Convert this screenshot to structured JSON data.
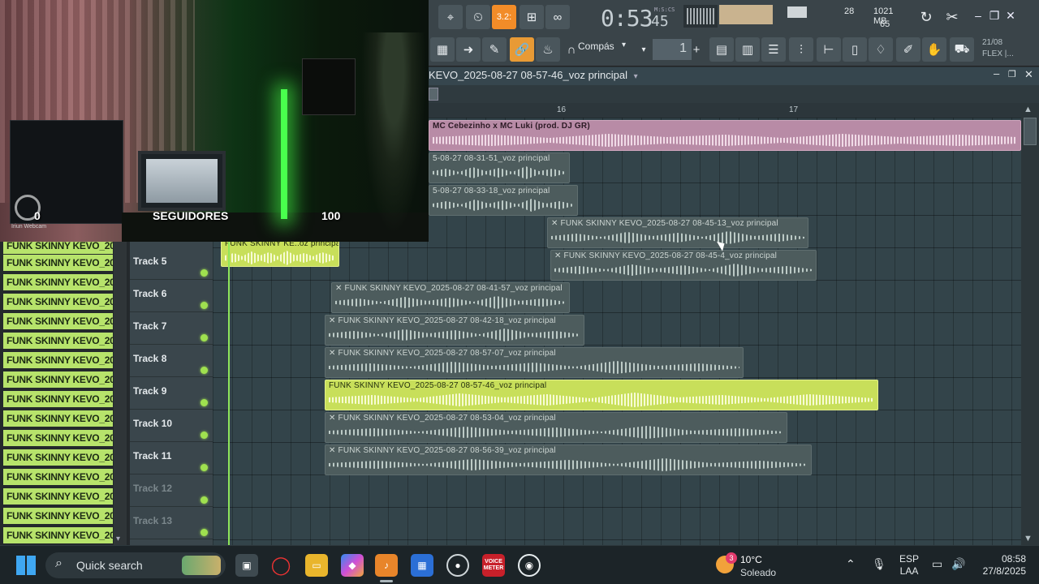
{
  "webcam": {
    "stat_left": "0",
    "stat_center": "SEGUIDORES",
    "stat_right": "100",
    "cam_label": "Iriun Webcam"
  },
  "toolbar": {
    "time": "0:53",
    "time_frac": "45",
    "time_unit": "M:S:CS",
    "tempo_display": "3.2:",
    "cpu_value": "28",
    "ram_value": "1021 MB",
    "poly_value": "65",
    "snap_label": "Compás",
    "pattern_number": "1",
    "pattern_plus": "+",
    "date_line1": "21/08",
    "date_line2": "FLEX |...",
    "date_sup": "2",
    "minimize": "–",
    "restore": "❐",
    "close": "✕"
  },
  "playlist": {
    "title": "KEVO_2025-08-27 08-57-46_voz principal",
    "ruler": [
      "16",
      "17"
    ],
    "minimize": "–",
    "restore": "❐",
    "close": "✕"
  },
  "browser": {
    "items": [
      "FUNK SKINNY KEVO_2025...",
      "FUNK SKINNY KEVO_2025...",
      "FUNK SKINNY KEVO_2025...",
      "FUNK SKINNY KEVO_2025...",
      "FUNK SKINNY KEVO_2025...",
      "FUNK SKINNY KEVO_2025...",
      "FUNK SKINNY KEVO_2025...",
      "FUNK SKINNY KEVO_2025...",
      "FUNK SKINNY KEVO_2025...",
      "FUNK SKINNY KEVO_2025...",
      "FUNK SKINNY KEVO_2025...",
      "FUNK SKINNY KEVO_2025...",
      "FUNK SKINNY KEVO_2025...",
      "FUNK SKINNY KEVO_2025...",
      "FUNK SKINNY KEVO_2025...",
      "FUNK SKINNY KEVO_2025..."
    ]
  },
  "tracks": [
    {
      "name": "Track 5"
    },
    {
      "name": "Track 6"
    },
    {
      "name": "Track 7"
    },
    {
      "name": "Track 8"
    },
    {
      "name": "Track 9"
    },
    {
      "name": "Track 10"
    },
    {
      "name": "Track 11"
    },
    {
      "name": "Track 12"
    },
    {
      "name": "Track 13"
    }
  ],
  "clips": {
    "c1": "MC Cebezinho x MC Luki (prod. DJ GR)",
    "c2": "5-08-27 08-31-51_voz principal",
    "c3": "5-08-27 08-33-18_voz principal",
    "c4": "✕ FUNK SKINNY KEVO_2025-08-27 08-45-13_voz principal",
    "c5": "FUNK SKINNY KE..oz principal",
    "c6": "✕ FUNK SKINNY KEVO_2025-08-27 08-45-4_voz principal",
    "c7": "✕ FUNK SKINNY KEVO_2025-08-27 08-41-57_voz principal",
    "c8": "✕ FUNK SKINNY KEVO_2025-08-27 08-42-18_voz principal",
    "c9": "✕ FUNK SKINNY KEVO_2025-08-27 08-57-07_voz principal",
    "c10": "FUNK SKINNY KEVO_2025-08-27 08-57-46_voz principal",
    "c11": "✕ FUNK SKINNY KEVO_2025-08-27 08-53-04_voz principal",
    "c12": "✕ FUNK SKINNY KEVO_2025-08-27 08-56-39_voz principal"
  },
  "taskbar": {
    "search_placeholder": "Quick search",
    "weather_badge": "3",
    "weather_temp": "10°C",
    "weather_desc": "Soleado",
    "lang_line1": "ESP",
    "lang_line2": "LAA",
    "clock_time": "08:58",
    "clock_date": "27/8/2025",
    "voice_label": "VOICE\nMEETER"
  }
}
